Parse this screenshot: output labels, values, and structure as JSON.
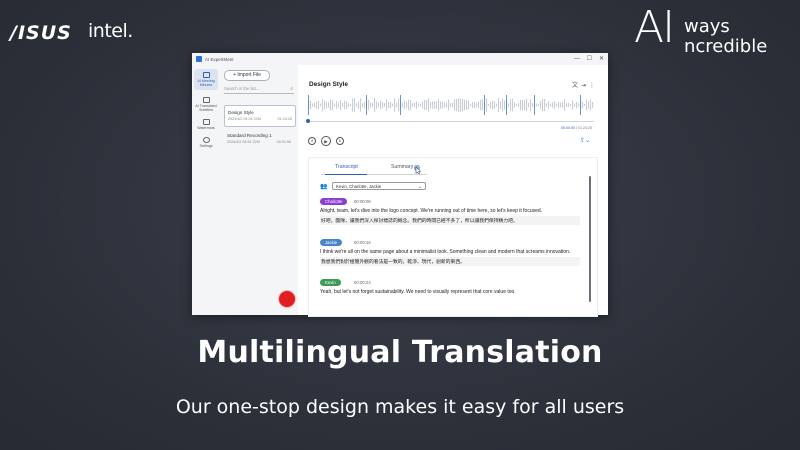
{
  "brand": {
    "asus": "/ISUS",
    "intel": "intel.",
    "slogan_big": "AI",
    "slogan_word1": "ways",
    "slogan_word2": "ncredible"
  },
  "window": {
    "title": "AI ExpertMeet",
    "controls": [
      "—",
      "☐",
      "✕"
    ]
  },
  "rail": {
    "items": [
      {
        "label": "AI Meeting Minutes",
        "icon": "document-icon",
        "active": true
      },
      {
        "label": "AI Translated Subtitles",
        "icon": "subtitles-icon",
        "active": false
      },
      {
        "label": "Watermark",
        "icon": "monitor-icon",
        "active": false
      },
      {
        "label": "Settings",
        "icon": "gear-icon",
        "active": false
      }
    ]
  },
  "list": {
    "import_label": "Import File",
    "search_placeholder": "Search in the list...",
    "recordings": [
      {
        "name": "Design Style",
        "date": "2024/4/2  04:24  22M",
        "duration": "01:24:25",
        "selected": true
      },
      {
        "name": "Standard Recording 1",
        "date": "2024/4/2  04:54  22M",
        "duration": "00:01:56",
        "selected": false
      }
    ]
  },
  "player": {
    "title": "Design Style",
    "current_time": "00:00:00",
    "total_time": "01:24:25",
    "progress": 0.0
  },
  "tabs": {
    "transcript": "Transcript",
    "summary": "Summary"
  },
  "speakers_select": "Kevin, Charlotte, Jackie",
  "transcript": [
    {
      "speaker": "Charlotte",
      "color": "#8a3fd1",
      "time": "00:00:06",
      "en": "Alright, team, let's dive into the logo concept. We're running out of time here, so let's keep it focused.",
      "zh": "好吧，團隊，讓我們深入探討標誌的概念。我們的時間已經不多了，所以讓我們保持精力吧。"
    },
    {
      "speaker": "Jackie",
      "color": "#4a86c6",
      "time": "00:00:16",
      "en": "I think we're all on the same page about a minimalist look. Something clean and modern that screams innovation.",
      "zh": "我想我們對於極簡外觀的看法是一致的。乾淨、現代，創新的東西。"
    },
    {
      "speaker": "Kevin",
      "color": "#3f9a55",
      "time": "00:00:24",
      "en": "Yeah, but let's not forget sustainability. We need to visually represent that core value too.",
      "zh": ""
    }
  ],
  "caption": {
    "headline": "Multilingual Translation",
    "subline": "Our one-stop design makes it easy for all users"
  }
}
